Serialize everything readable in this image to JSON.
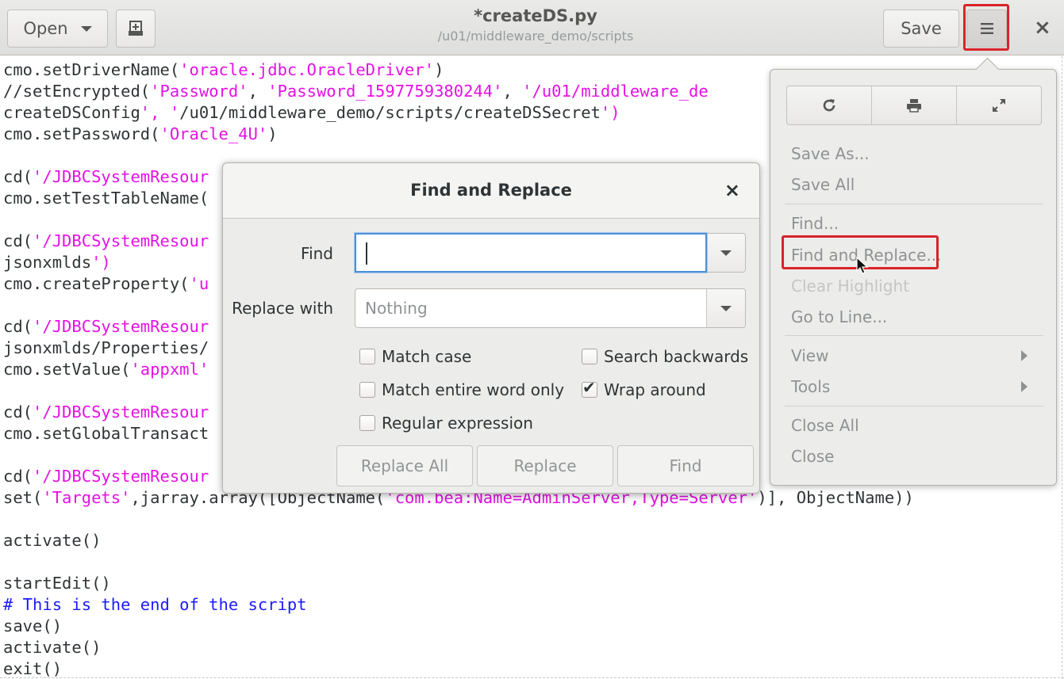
{
  "header": {
    "open_label": "Open",
    "new_tab_icon": "new-document-icon",
    "title": "*createDS.py",
    "subtitle": "/u01/middleware_demo/scripts",
    "save_label": "Save",
    "menu_icon": "hamburger-icon",
    "close_glyph": "×"
  },
  "editor": {
    "language": "python",
    "lines": [
      "cmo.setDriverName('oracle.jdbc.OracleDriver')",
      "//setEncrypted('Password', 'Password_1597759380244', '/u01/middleware_de",
      "createDSConfig', '/u01/middleware_demo/scripts/createDSSecret')",
      "cmo.setPassword('Oracle_4U')",
      "",
      "cd('/JDBCSystemResour",
      "cmo.setTestTableName(",
      "",
      "cd('/JDBCSystemResour",
      "jsonxmlds')",
      "cmo.createProperty('u",
      "",
      "cd('/JDBCSystemResour",
      "jsonxmlds/Properties/",
      "cmo.setValue('appxml'",
      "",
      "cd('/JDBCSystemResour",
      "cmo.setGlobalTransact",
      "",
      "cd('/JDBCSystemResour",
      "set('Targets',jarray.array([ObjectName('com.bea:Name=AdminServer,Type=Server')], ObjectName))",
      "",
      "activate()",
      "",
      "startEdit()",
      "# This is the end of the script",
      "save()",
      "activate()",
      "exit()"
    ]
  },
  "dialog": {
    "title": "Find and Replace",
    "close_glyph": "×",
    "find_label": "Find",
    "find_value": "",
    "replace_label": "Replace with",
    "replace_placeholder": "Nothing",
    "options": {
      "match_case": {
        "label": "Match case",
        "checked": false
      },
      "search_backwards": {
        "label": "Search backwards",
        "checked": false
      },
      "match_entire_word": {
        "label": "Match entire word only",
        "checked": false
      },
      "wrap_around": {
        "label": "Wrap around",
        "checked": true
      },
      "regular_expression": {
        "label": "Regular expression",
        "checked": false
      }
    },
    "buttons": {
      "replace_all": "Replace All",
      "replace": "Replace",
      "find": "Find"
    }
  },
  "menu": {
    "icons": [
      "reload-icon",
      "print-icon",
      "fullscreen-icon"
    ],
    "items": {
      "save_as": "Save As...",
      "save_all": "Save All",
      "find": "Find...",
      "find_and_replace": "Find and Replace...",
      "clear_highlight": "Clear Highlight",
      "go_to_line": "Go to Line...",
      "view": "View",
      "tools": "Tools",
      "close_all": "Close All",
      "close": "Close"
    }
  },
  "colors": {
    "string": "#e411e4",
    "comment": "#1b1bff",
    "highlight_box": "#d8232a",
    "focus_ring": "#4a90d9"
  }
}
